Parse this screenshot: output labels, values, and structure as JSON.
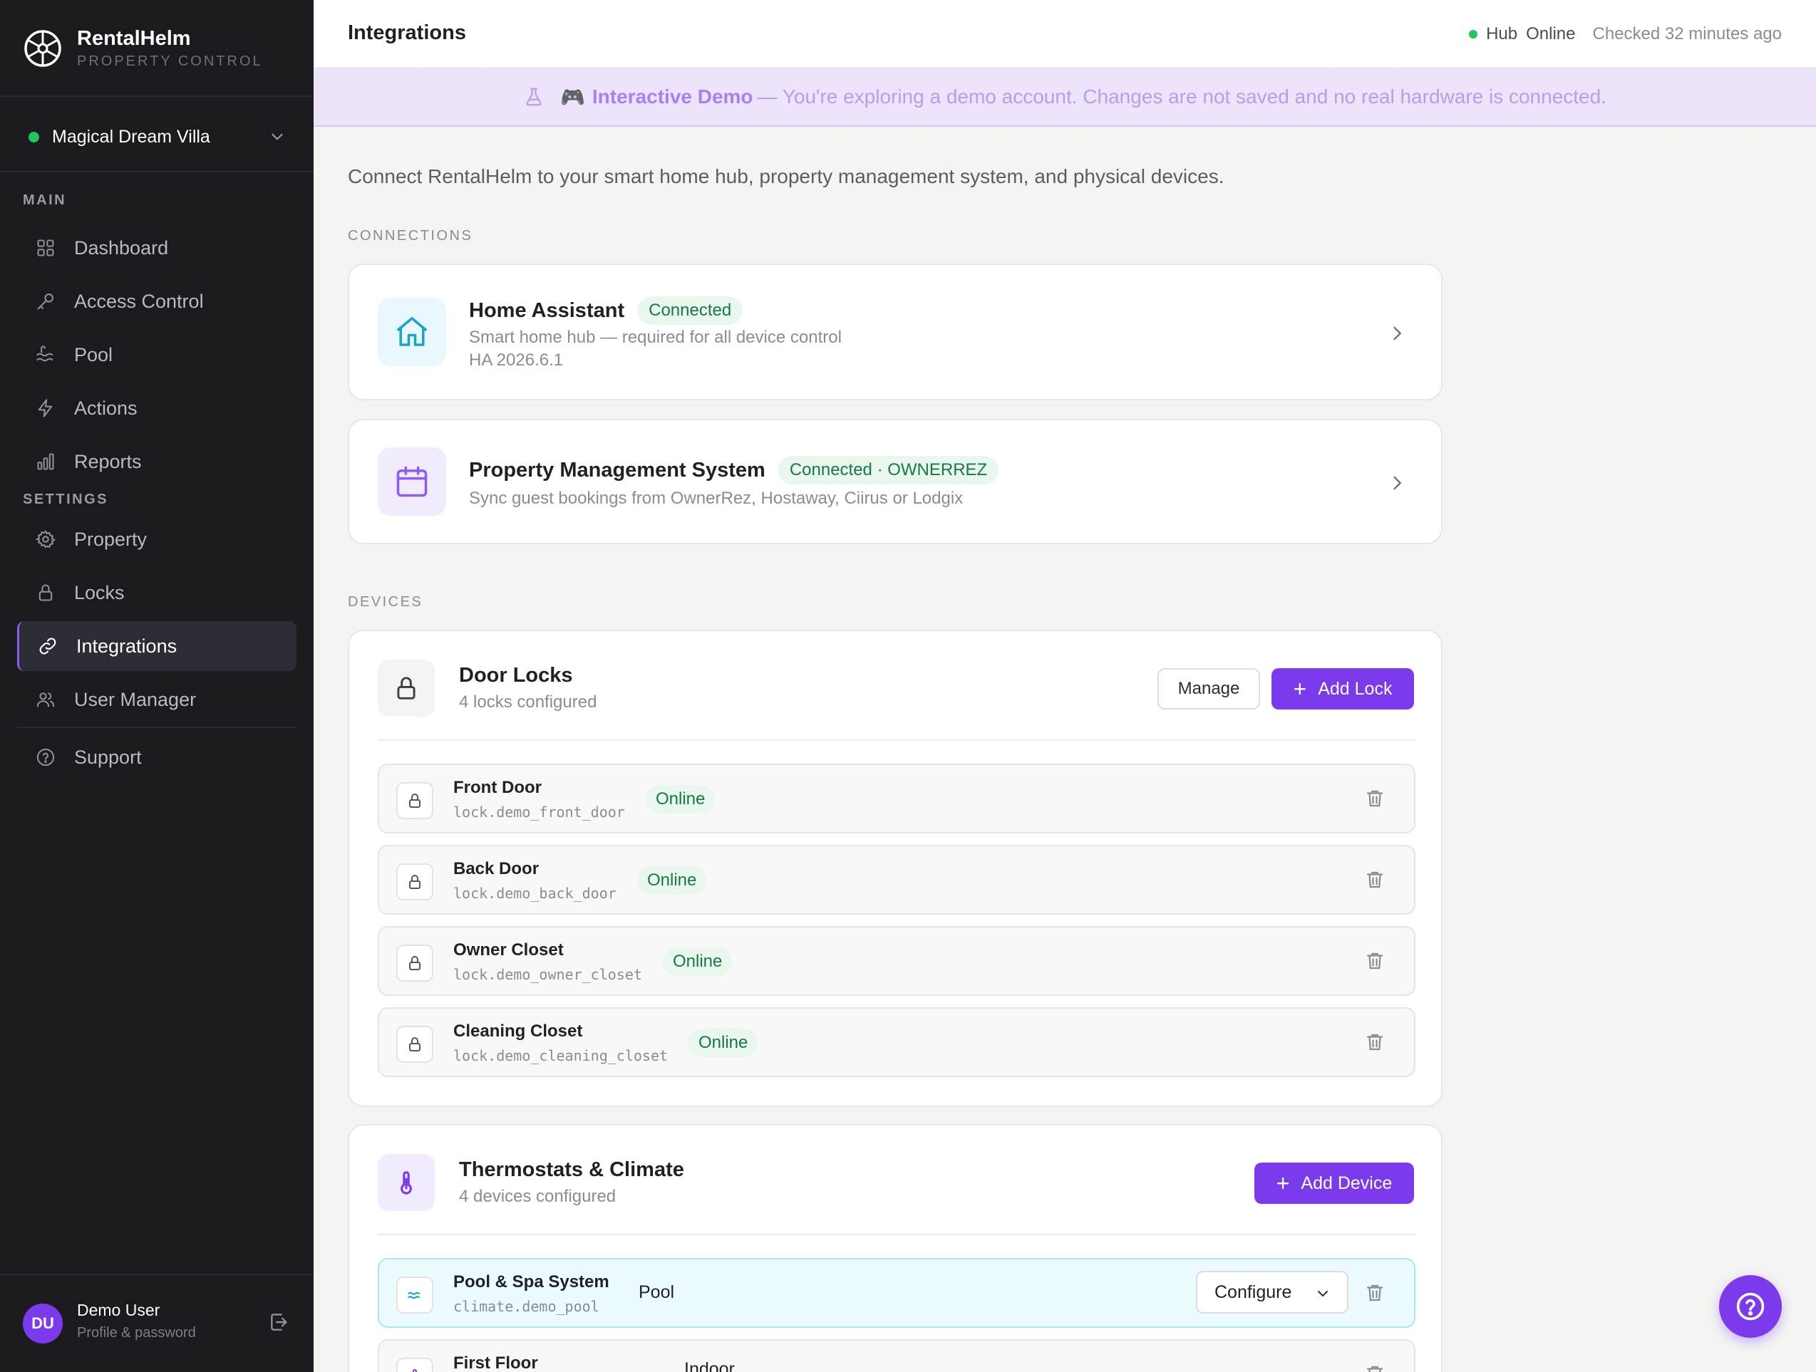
{
  "brand": {
    "name": "RentalHelm",
    "subtitle": "PROPERTY CONTROL"
  },
  "property_selector": {
    "value": "Magical Dream Villa",
    "status_color": "#22c55e"
  },
  "sidebar": {
    "sections": {
      "main": "MAIN",
      "settings": "SETTINGS"
    },
    "items": [
      {
        "label": "Dashboard",
        "icon": "grid-icon"
      },
      {
        "label": "Access Control",
        "icon": "key-icon"
      },
      {
        "label": "Pool",
        "icon": "waves-icon"
      },
      {
        "label": "Actions",
        "icon": "lightning-icon"
      },
      {
        "label": "Reports",
        "icon": "bar-chart-icon"
      },
      {
        "label": "Property",
        "icon": "gear-icon"
      },
      {
        "label": "Locks",
        "icon": "lock-icon"
      },
      {
        "label": "Integrations",
        "icon": "link-icon",
        "active": true
      },
      {
        "label": "User Manager",
        "icon": "users-icon"
      },
      {
        "label": "Support",
        "icon": "help-circle-icon"
      }
    ]
  },
  "user": {
    "initials": "DU",
    "name": "Demo User",
    "subtitle": "Profile & password"
  },
  "header": {
    "title": "Integrations",
    "hub_label": "Hub",
    "hub_state": "Online",
    "checked": "Checked 32 minutes ago"
  },
  "demo_banner": {
    "emoji": "🎮",
    "title": "Interactive Demo",
    "message": "— You're exploring a demo account. Changes are not saved and no real hardware is connected."
  },
  "intro": "Connect RentalHelm to your smart home hub, property management system, and physical devices.",
  "sections": {
    "connections": "CONNECTIONS",
    "devices": "DEVICES"
  },
  "connections": [
    {
      "title": "Home Assistant",
      "status": "Connected",
      "subtitle": "Smart home hub — required for all device control",
      "version": "HA 2026.6.1",
      "icon": "home-icon"
    },
    {
      "title": "Property Management System",
      "status": "Connected · OWNERREZ",
      "subtitle": "Sync guest bookings from OwnerRez, Hostaway, Ciirus or Lodgix",
      "icon": "calendar-icon"
    }
  ],
  "door_locks": {
    "title": "Door Locks",
    "subtitle": "4 locks configured",
    "manage_label": "Manage",
    "add_label": "Add Lock",
    "rows": [
      {
        "name": "Front Door",
        "entity": "lock.demo_front_door",
        "status": "Online"
      },
      {
        "name": "Back Door",
        "entity": "lock.demo_back_door",
        "status": "Online"
      },
      {
        "name": "Owner Closet",
        "entity": "lock.demo_owner_closet",
        "status": "Online"
      },
      {
        "name": "Cleaning Closet",
        "entity": "lock.demo_cleaning_closet",
        "status": "Online"
      }
    ]
  },
  "thermostats": {
    "title": "Thermostats & Climate",
    "subtitle": "4 devices configured",
    "add_label": "Add Device",
    "rows": [
      {
        "name": "Pool & Spa System",
        "entity": "climate.demo_pool",
        "type": "Pool",
        "configure_label": "Configure"
      },
      {
        "name": "First Floor",
        "entity": "",
        "type": "Indoor"
      }
    ]
  },
  "colors": {
    "accent": "#7c3aed",
    "online": "#167a45",
    "sidebar_bg": "#1a1a1f"
  }
}
